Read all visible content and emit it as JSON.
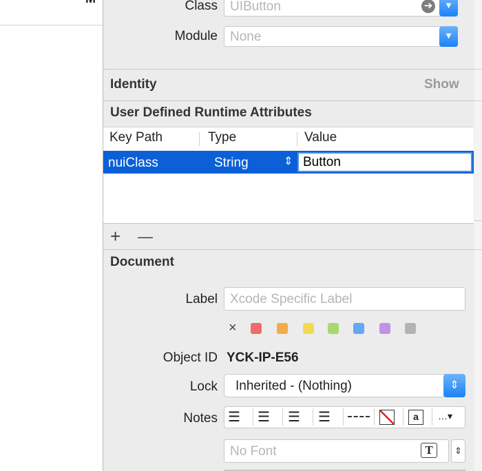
{
  "left": {
    "peek_text": "M"
  },
  "custom_class": {
    "class_label": "Class",
    "class_value": "UIButton",
    "module_label": "Module",
    "module_value": "None"
  },
  "identity": {
    "title": "Identity",
    "show_label": "Show"
  },
  "runtime_attributes": {
    "title": "User Defined Runtime Attributes",
    "columns": [
      "Key Path",
      "Type",
      "Value"
    ],
    "rows": [
      {
        "key_path": "nuiClass",
        "type": "String",
        "value": "Button"
      }
    ],
    "add_label": "+",
    "remove_label": "—"
  },
  "document": {
    "title": "Document",
    "label_label": "Label",
    "label_placeholder": "Xcode Specific Label",
    "color_clear_label": "×",
    "label_colors": [
      "#f06b6b",
      "#f5ab4b",
      "#f1db55",
      "#a9d86e",
      "#62a8f4",
      "#c290e5",
      "#b3b3b3"
    ],
    "object_id_label": "Object ID",
    "object_id_value": "YCK-IP-E56",
    "lock_label": "Lock",
    "lock_value": "Inherited - (Nothing)",
    "notes_label": "Notes",
    "font_value": "No Font"
  }
}
